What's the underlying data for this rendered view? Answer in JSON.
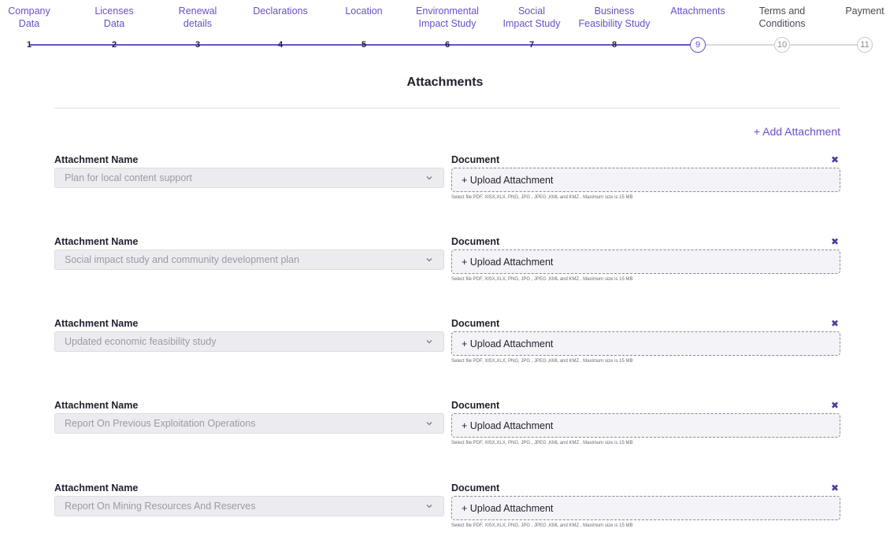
{
  "stepper": {
    "steps": [
      {
        "number": "1",
        "label": "Company\nData",
        "state": "done"
      },
      {
        "number": "2",
        "label": "Licenses\nData",
        "state": "done"
      },
      {
        "number": "3",
        "label": "Renewal\ndetails",
        "state": "done"
      },
      {
        "number": "4",
        "label": "Declarations",
        "state": "done"
      },
      {
        "number": "5",
        "label": "Location",
        "state": "done"
      },
      {
        "number": "6",
        "label": "Environmental\nImpact Study",
        "state": "done"
      },
      {
        "number": "7",
        "label": "Social\nImpact Study",
        "state": "done"
      },
      {
        "number": "8",
        "label": "Business\nFeasibility Study",
        "state": "done"
      },
      {
        "number": "9",
        "label": "Attachments",
        "state": "current"
      },
      {
        "number": "10",
        "label": "Terms and\nConditions",
        "state": "todo"
      },
      {
        "number": "11",
        "label": "Payment",
        "state": "todo"
      }
    ]
  },
  "page": {
    "title": "Attachments",
    "add_attachment_label": "+ Add Attachment"
  },
  "labels": {
    "attachment_name": "Attachment Name",
    "document": "Document",
    "upload": "+ Upload Attachment",
    "hint": "Select file PDF, XlSX,XLX, PNG, JPG , JPEG ,KML and KMZ , Maximum size is 15 MB"
  },
  "attachments": [
    {
      "name": "Plan for local content support"
    },
    {
      "name": "Social impact study and community development plan"
    },
    {
      "name": "Updated economic feasibility study"
    },
    {
      "name": "Report On Previous Exploitation Operations"
    },
    {
      "name": "Report On Mining Resources And Reserves"
    }
  ],
  "colors": {
    "accent": "#6a4fc8",
    "remove": "#4d3a9e",
    "select_bg": "#ececf0",
    "upload_bg": "#f4f4f8"
  }
}
